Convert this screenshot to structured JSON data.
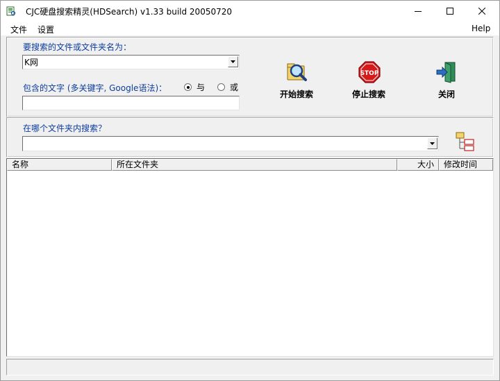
{
  "window": {
    "title": "CJC硬盘搜索精灵(HDSearch) v1.33 build 20050720"
  },
  "menu": {
    "file": "文件",
    "settings": "设置",
    "help": "Help"
  },
  "search": {
    "filename_label": "要搜索的文件或文件夹名为：",
    "filename_value": "K网",
    "content_label": "包含的文字 (多关键字, Google语法)：",
    "content_value": "",
    "logic_and": "与",
    "logic_or": "或",
    "logic_selected": "and",
    "folder_label": "在哪个文件夹内搜索？",
    "folder_value": ""
  },
  "toolbar": {
    "start_label": "开始搜索",
    "stop_label": "停止搜索",
    "stop_sign_text": "STOP",
    "close_label": "关闭"
  },
  "results": {
    "columns": [
      "名称",
      "所在文件夹",
      "大小",
      "修改时间"
    ]
  },
  "colors": {
    "label_blue": "#0c3c9c",
    "stop_red": "#d61a1a"
  },
  "icons": {
    "start": "magnifier-folder-icon",
    "stop": "stop-sign-icon",
    "close": "exit-door-icon",
    "browse": "folder-tree-icon"
  }
}
